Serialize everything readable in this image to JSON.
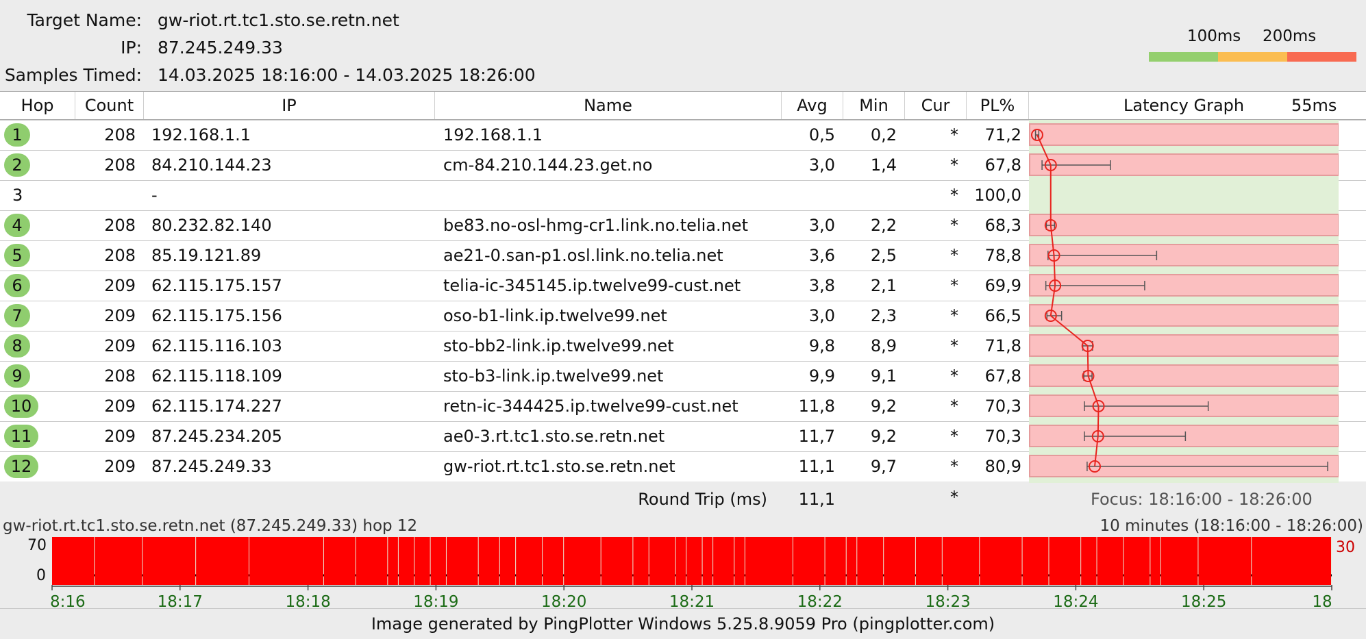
{
  "header": {
    "target_label": "Target Name:",
    "target_value": "gw-riot.rt.tc1.sto.se.retn.net",
    "ip_label": "IP:",
    "ip_value": "87.245.249.33",
    "samples_label": "Samples Timed:",
    "samples_value": "14.03.2025 18:16:00 - 14.03.2025 18:26:00"
  },
  "scale": {
    "label_100": "100ms",
    "label_200": "200ms",
    "colors": [
      "#94cf6e",
      "#fbbd51",
      "#f86a51"
    ]
  },
  "columns": {
    "hop": "Hop",
    "count": "Count",
    "ip": "IP",
    "name": "Name",
    "avg": "Avg",
    "min": "Min",
    "cur": "Cur",
    "pl": "PL%",
    "graph": "Latency Graph",
    "graph_scale": "55ms"
  },
  "graph_scale_ms": 55,
  "hops": [
    {
      "hop": "1",
      "count": "208",
      "ip": "192.168.1.1",
      "name": "192.168.1.1",
      "avg": "0,5",
      "min": "0,2",
      "cur": "*",
      "pl": "71,2",
      "lat": 0.5,
      "lo": 0.2,
      "hi": 0.8,
      "bar": true
    },
    {
      "hop": "2",
      "count": "208",
      "ip": "84.210.144.23",
      "name": "cm-84.210.144.23.get.no",
      "avg": "3,0",
      "min": "1,4",
      "cur": "*",
      "pl": "67,8",
      "lat": 3.0,
      "lo": 1.4,
      "hi": 14.0,
      "bar": true
    },
    {
      "hop": "3",
      "count": "",
      "ip": "-",
      "name": "",
      "avg": "",
      "min": "",
      "cur": "*",
      "pl": "100,0",
      "lat": null,
      "lo": null,
      "hi": null,
      "bar": false
    },
    {
      "hop": "4",
      "count": "208",
      "ip": "80.232.82.140",
      "name": "be83.no-osl-hmg-cr1.link.no.telia.net",
      "avg": "3,0",
      "min": "2,2",
      "cur": "*",
      "pl": "68,3",
      "lat": 3.0,
      "lo": 2.2,
      "hi": 3.7,
      "bar": true
    },
    {
      "hop": "5",
      "count": "208",
      "ip": "85.19.121.89",
      "name": "ae21-0.san-p1.osl.link.no.telia.net",
      "avg": "3,6",
      "min": "2,5",
      "cur": "*",
      "pl": "78,8",
      "lat": 3.6,
      "lo": 2.5,
      "hi": 22.5,
      "bar": true
    },
    {
      "hop": "6",
      "count": "209",
      "ip": "62.115.175.157",
      "name": "telia-ic-345145.ip.twelve99-cust.net",
      "avg": "3,8",
      "min": "2,1",
      "cur": "*",
      "pl": "69,9",
      "lat": 3.8,
      "lo": 2.1,
      "hi": 20.3,
      "bar": true
    },
    {
      "hop": "7",
      "count": "209",
      "ip": "62.115.175.156",
      "name": "oso-b1-link.ip.twelve99.net",
      "avg": "3,0",
      "min": "2,3",
      "cur": "*",
      "pl": "66,5",
      "lat": 3.0,
      "lo": 2.3,
      "hi": 5.0,
      "bar": true
    },
    {
      "hop": "8",
      "count": "209",
      "ip": "62.115.116.103",
      "name": "sto-bb2-link.ip.twelve99.net",
      "avg": "9,8",
      "min": "8,9",
      "cur": "*",
      "pl": "71,8",
      "lat": 9.8,
      "lo": 8.9,
      "hi": 10.7,
      "bar": true
    },
    {
      "hop": "9",
      "count": "208",
      "ip": "62.115.118.109",
      "name": "sto-b3-link.ip.twelve99.net",
      "avg": "9,9",
      "min": "9,1",
      "cur": "*",
      "pl": "67,8",
      "lat": 9.9,
      "lo": 9.1,
      "hi": 10.6,
      "bar": true
    },
    {
      "hop": "10",
      "count": "209",
      "ip": "62.115.174.227",
      "name": "retn-ic-344425.ip.twelve99-cust.net",
      "avg": "11,8",
      "min": "9,2",
      "cur": "*",
      "pl": "70,3",
      "lat": 11.8,
      "lo": 9.2,
      "hi": 32.0,
      "bar": true
    },
    {
      "hop": "11",
      "count": "209",
      "ip": "87.245.234.205",
      "name": "ae0-3.rt.tc1.sto.se.retn.net",
      "avg": "11,7",
      "min": "9,2",
      "cur": "*",
      "pl": "70,3",
      "lat": 11.7,
      "lo": 9.2,
      "hi": 27.8,
      "bar": true
    },
    {
      "hop": "12",
      "count": "209",
      "ip": "87.245.249.33",
      "name": "gw-riot.rt.tc1.sto.se.retn.net",
      "avg": "11,1",
      "min": "9,7",
      "cur": "*",
      "pl": "80,9",
      "lat": 11.1,
      "lo": 9.7,
      "hi": 54.0,
      "bar": true
    }
  ],
  "summary": {
    "label": "Round Trip (ms)",
    "avg": "11,1",
    "cur": "*",
    "focus": "Focus: 18:16:00 - 18:26:00"
  },
  "timeline": {
    "title": "gw-riot.rt.tc1.sto.se.retn.net (87.245.249.33) hop 12",
    "range": "10 minutes (18:16:00 - 18:26:00)",
    "y_top": "70",
    "y_zero": "0",
    "right_value": "30",
    "ticks": [
      "8:16",
      "18:17",
      "18:18",
      "18:19",
      "18:20",
      "18:21",
      "18:22",
      "18:23",
      "18:24",
      "18:25",
      "18"
    ],
    "segments": [
      [
        0,
        7
      ],
      [
        8,
        16
      ],
      [
        17,
        26
      ],
      [
        27,
        36
      ],
      [
        37,
        50
      ],
      [
        51,
        56
      ],
      [
        57,
        62
      ],
      [
        63,
        64
      ],
      [
        65,
        67
      ],
      [
        68,
        70
      ],
      [
        71,
        73
      ],
      [
        74,
        79
      ],
      [
        80,
        83
      ],
      [
        84,
        86
      ],
      [
        87,
        91
      ],
      [
        92,
        95
      ],
      [
        96,
        102
      ],
      [
        103,
        108
      ],
      [
        109,
        111
      ],
      [
        112,
        116
      ],
      [
        117,
        118
      ],
      [
        119,
        121
      ],
      [
        122,
        123
      ],
      [
        124,
        127
      ],
      [
        128,
        129
      ],
      [
        130,
        138
      ],
      [
        139,
        144
      ],
      [
        145,
        148
      ],
      [
        149,
        150
      ],
      [
        151,
        155
      ],
      [
        156,
        161
      ],
      [
        162,
        166
      ],
      [
        167,
        173
      ],
      [
        174,
        181
      ],
      [
        182,
        186
      ],
      [
        187,
        192
      ],
      [
        193,
        195
      ],
      [
        196,
        200
      ],
      [
        201,
        205
      ],
      [
        206,
        207
      ],
      [
        208,
        214
      ],
      [
        215,
        224
      ],
      [
        225,
        239
      ]
    ],
    "total_units": 240,
    "bar_color": "#ff0000"
  },
  "footer": {
    "text": "Image generated by PingPlotter Windows 5.25.8.9059 Pro (pingplotter.com)"
  }
}
